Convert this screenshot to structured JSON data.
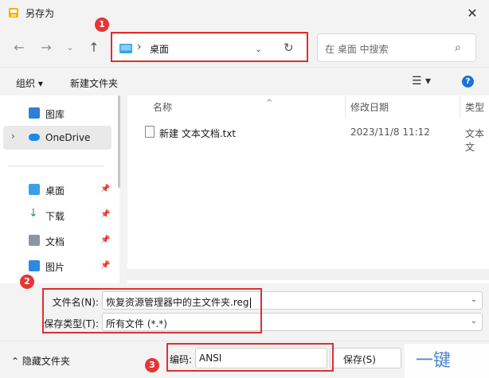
{
  "window": {
    "title": "另存为"
  },
  "nav": {
    "address_path": "桌面",
    "search_placeholder": "在 桌面 中搜索"
  },
  "toolbar": {
    "organize_label": "组织 ▾",
    "new_folder_label": "新建文件夹"
  },
  "sidebar": {
    "items": [
      {
        "label": "图库"
      },
      {
        "label": "OneDrive"
      },
      {
        "label": "桌面"
      },
      {
        "label": "下载"
      },
      {
        "label": "文档"
      },
      {
        "label": "图片"
      }
    ]
  },
  "files": {
    "columns": [
      "名称",
      "修改日期",
      "类型"
    ],
    "rows": [
      {
        "name": "新建 文本文档.txt",
        "date": "2023/11/8 11:12",
        "type": "文本文"
      }
    ]
  },
  "form": {
    "filename_label": "文件名(N):",
    "filename_value": "恢复资源管理器中的主文件夹.reg",
    "filetype_label": "保存类型(T):",
    "filetype_value": "所有文件 (*.*)"
  },
  "bottom": {
    "hide_folders_label": "隐藏文件夹",
    "encoding_label": "编码:",
    "encoding_value": "ANSI",
    "save_label": "保存(S)"
  },
  "annotations": {
    "badge1": "1",
    "badge2": "2",
    "badge3": "3"
  },
  "colors": {
    "accent": "#1a73d9",
    "highlight": "#e02e2e"
  },
  "watermark": {
    "text": "一键"
  }
}
